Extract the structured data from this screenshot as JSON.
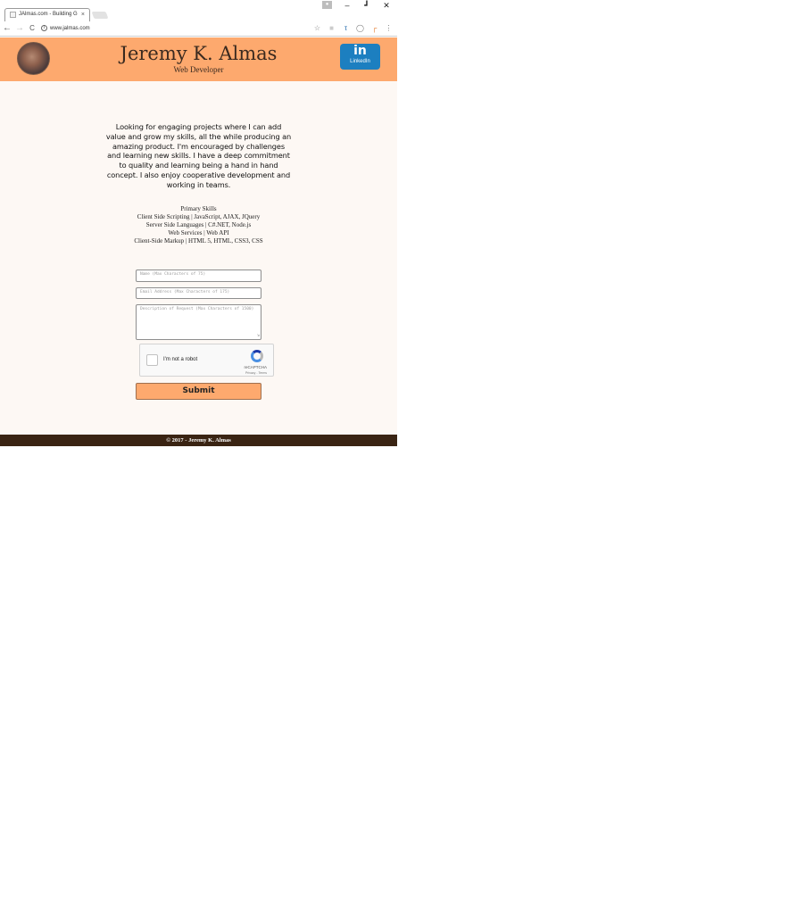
{
  "browser": {
    "tab_title": "JAlmas.com - Building G",
    "tab_close": "×",
    "url": "www.jalmas.com",
    "info_icon": "i",
    "window_controls": {
      "minimize": "–",
      "maximize": "□",
      "close": "✕"
    },
    "nav": {
      "back": "←",
      "forward": "→",
      "reload": "C"
    },
    "extensions": [
      "star-icon",
      "extension-icon",
      "translate-icon",
      "account-icon",
      "bookmark-icon",
      "menu-icon"
    ]
  },
  "header": {
    "title": "Jeremy K. Almas",
    "subtitle": "Web Developer",
    "linkedin": {
      "badge": "in",
      "label": "LinkedIn",
      "color": "#1c7fc0"
    },
    "background": "#fda96e"
  },
  "intro": "Looking for engaging projects where I can add value and grow my skills, all the while producing an amazing product. I'm encouraged by challenges and learning new skills. I have a deep commitment to quality and learning being a hand in hand concept. I also enjoy cooperative development and working in teams.",
  "skills": {
    "heading": "Primary Skills",
    "lines": [
      "Client Side Scripting | JavaScript, AJAX, JQuery",
      "Server Side Languages | C#.NET, Node.js",
      "Web Services | Web API",
      "Client-Side Markup | HTML 5, HTML, CSS3, CSS"
    ]
  },
  "form": {
    "name_placeholder": "Name (Max Characters of 75)",
    "email_placeholder": "Email Address (Max Characters of 175)",
    "message_placeholder": "Description of Request (Max Characters of 1500)",
    "captcha_label": "I'm not a robot",
    "captcha_brand": "reCAPTCHA",
    "captcha_terms": "Privacy - Terms",
    "submit_label": "Submit"
  },
  "footer": "© 2017 - Jeremy K. Almas"
}
